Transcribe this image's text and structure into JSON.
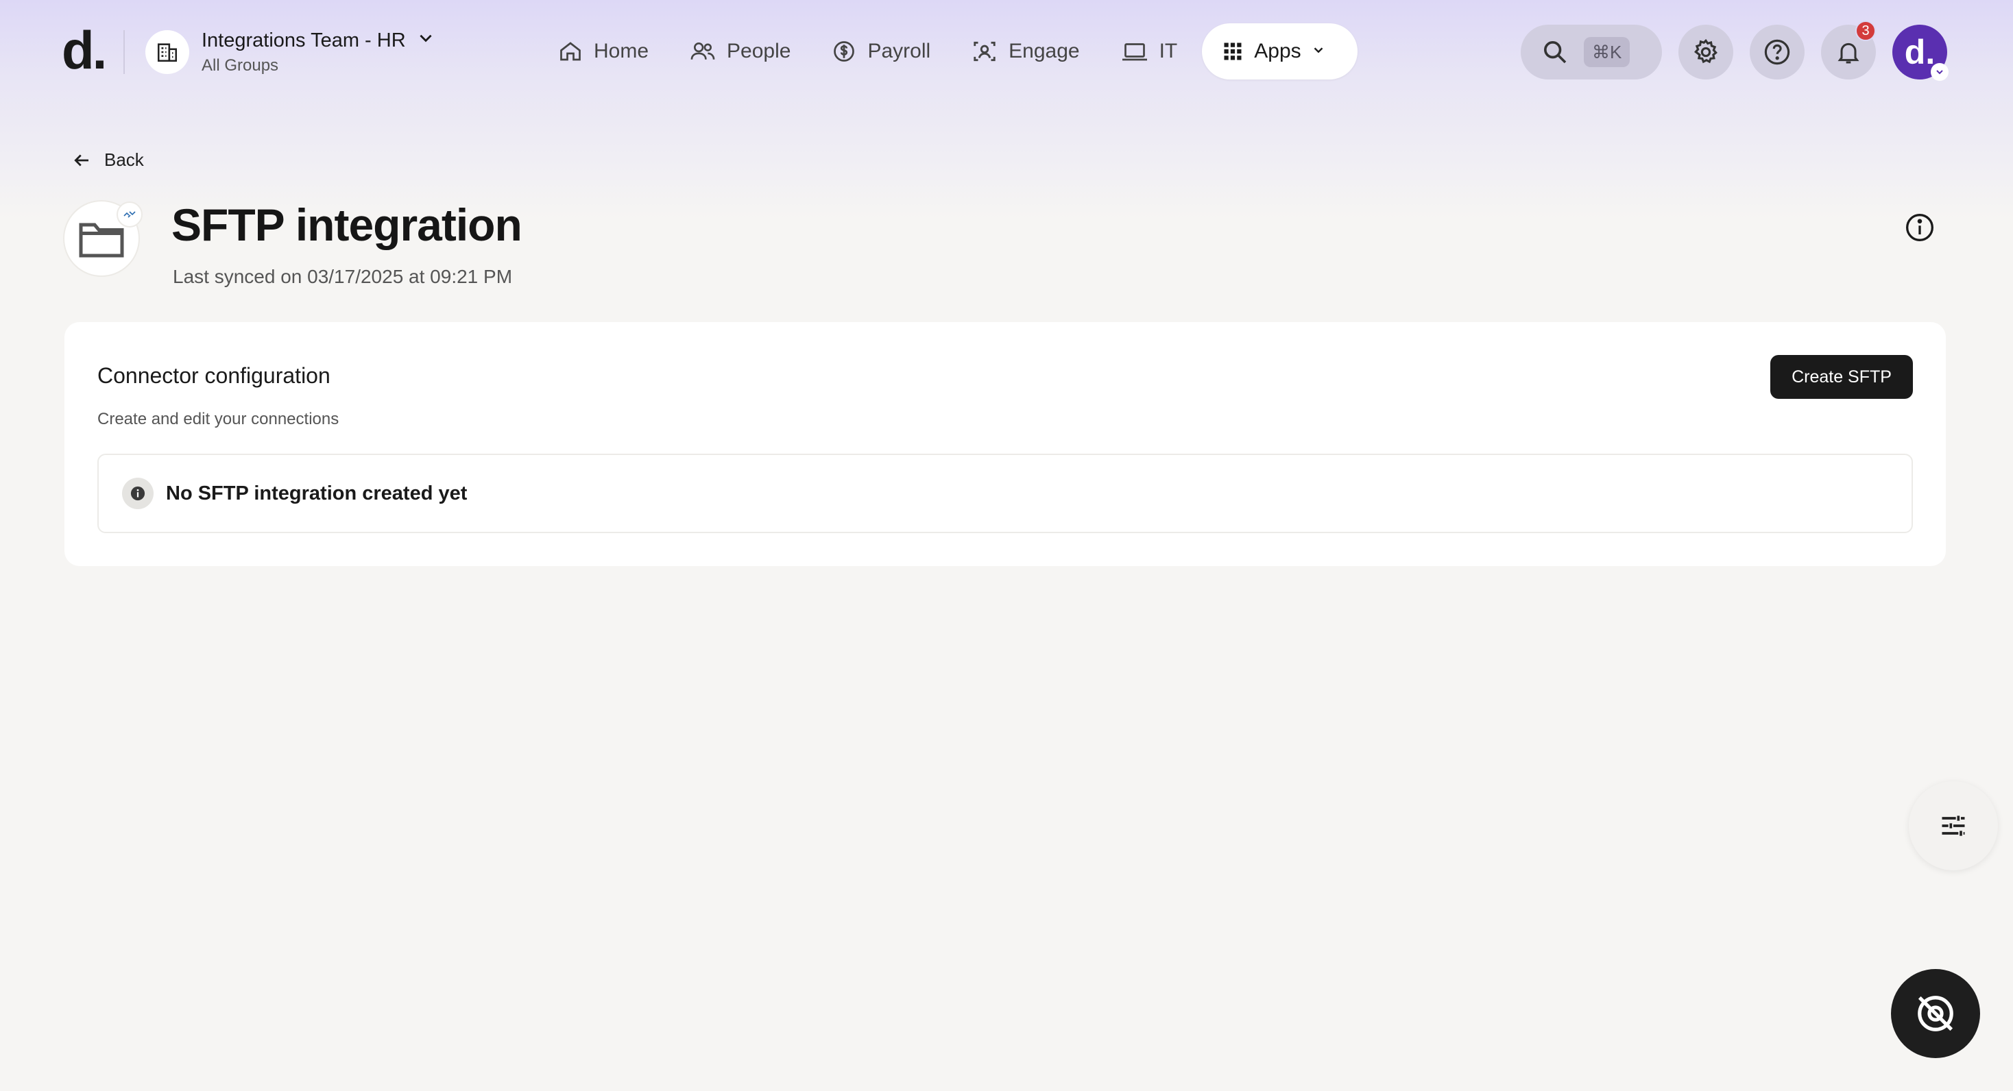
{
  "app": {
    "logo_text": "d."
  },
  "org": {
    "name": "Integrations Team - HR",
    "subtitle": "All Groups"
  },
  "nav": {
    "items": [
      {
        "label": "Home",
        "icon": "home-icon"
      },
      {
        "label": "People",
        "icon": "people-icon"
      },
      {
        "label": "Payroll",
        "icon": "dollar-icon"
      },
      {
        "label": "Engage",
        "icon": "engage-icon"
      },
      {
        "label": "IT",
        "icon": "laptop-icon"
      }
    ],
    "apps_label": "Apps"
  },
  "header": {
    "search_shortcut": "⌘K",
    "notification_count": "3",
    "avatar_text": "d."
  },
  "back_label": "Back",
  "page": {
    "title": "SFTP integration",
    "subtitle": "Last synced on 03/17/2025 at 09:21 PM"
  },
  "card": {
    "title": "Connector configuration",
    "subtitle": "Create and edit your connections",
    "create_button": "Create SFTP",
    "empty_message": "No SFTP integration created yet"
  },
  "colors": {
    "accent_purple": "#5a2fb0",
    "badge_red": "#d33b3b",
    "primary_button": "#1a1a1a"
  }
}
